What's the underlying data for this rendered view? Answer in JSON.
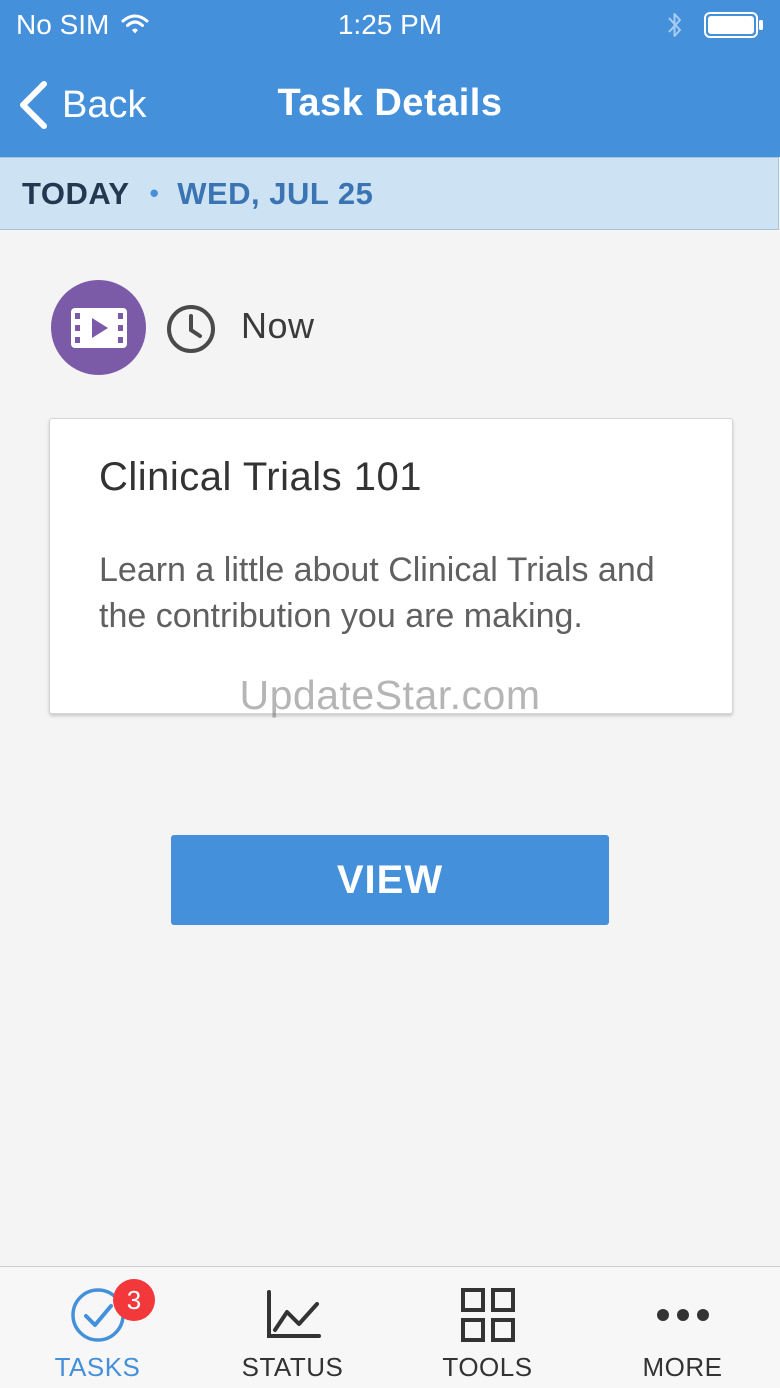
{
  "status_bar": {
    "carrier": "No SIM",
    "time": "1:25 PM"
  },
  "nav": {
    "back_label": "Back",
    "title": "Task Details"
  },
  "date_bar": {
    "today": "TODAY",
    "separator": "•",
    "date": "WED, JUL 25"
  },
  "task": {
    "icon": "video-icon",
    "time_icon": "clock-icon",
    "time_label": "Now",
    "title": "Clinical Trials 101",
    "description": "Learn a little about Clinical Trials and the contribution you are making."
  },
  "watermark": "UpdateStar.com",
  "view_button_label": "VIEW",
  "tab_bar": {
    "tabs": [
      {
        "label": "TASKS",
        "icon": "check-circle-icon",
        "badge": "3",
        "active": true
      },
      {
        "label": "STATUS",
        "icon": "line-chart-icon",
        "active": false
      },
      {
        "label": "TOOLS",
        "icon": "grid-icon",
        "active": false
      },
      {
        "label": "MORE",
        "icon": "ellipsis-icon",
        "active": false
      }
    ]
  },
  "colors": {
    "accent": "#4590db",
    "date_bar_bg": "#cde3f4",
    "task_icon_bg": "#7b5aa8",
    "badge": "#f2383a"
  }
}
